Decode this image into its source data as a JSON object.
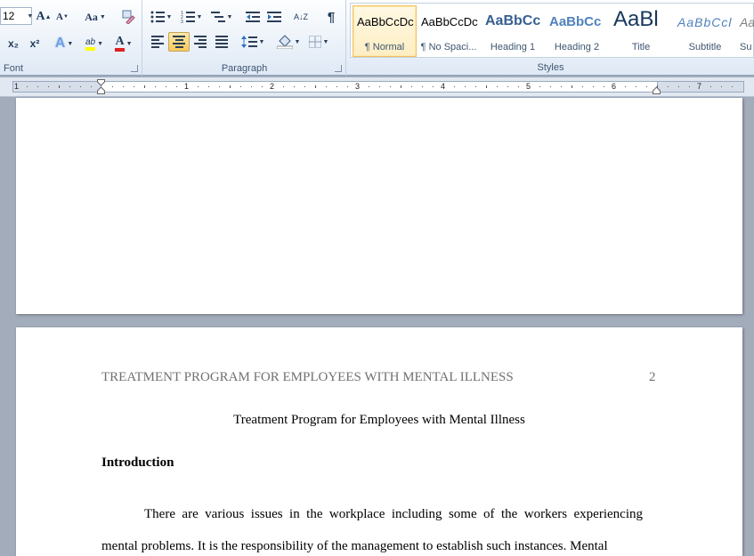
{
  "ribbon": {
    "font_group": {
      "label": "Font",
      "font_size": "12",
      "grow_font": "A",
      "shrink_font": "A",
      "change_case": "Aa",
      "subscript": "x₂",
      "superscript": "x²",
      "text_effects": "A",
      "highlight": "ab",
      "font_color": "A"
    },
    "paragraph_group": {
      "label": "Paragraph",
      "sort": "A↓Z",
      "pilcrow": "¶"
    },
    "styles_group": {
      "label": "Styles",
      "items": [
        {
          "preview": "AaBbCcDc",
          "name": "¶ Normal"
        },
        {
          "preview": "AaBbCcDc",
          "name": "¶ No Spaci..."
        },
        {
          "preview": "AaBbCc",
          "name": "Heading 1"
        },
        {
          "preview": "AaBbCc",
          "name": "Heading 2"
        },
        {
          "preview": "AaBl",
          "name": "Title"
        },
        {
          "preview": "AaBbCcl",
          "name": "Subtitle"
        },
        {
          "preview": "Aa",
          "name": "Su"
        }
      ]
    }
  },
  "ruler": {
    "numbers": [
      "1",
      "1",
      "2",
      "3",
      "4",
      "5",
      "6",
      "7"
    ]
  },
  "document": {
    "running_head": "TREATMENT PROGRAM FOR EMPLOYEES WITH MENTAL ILLNESS",
    "page_number": "2",
    "title": "Treatment Program for Employees with Mental Illness",
    "heading": "Introduction",
    "paragraph": "There are various issues in the workplace including some of the workers experiencing mental problems. It is the responsibility of the management to establish such instances. Mental"
  }
}
